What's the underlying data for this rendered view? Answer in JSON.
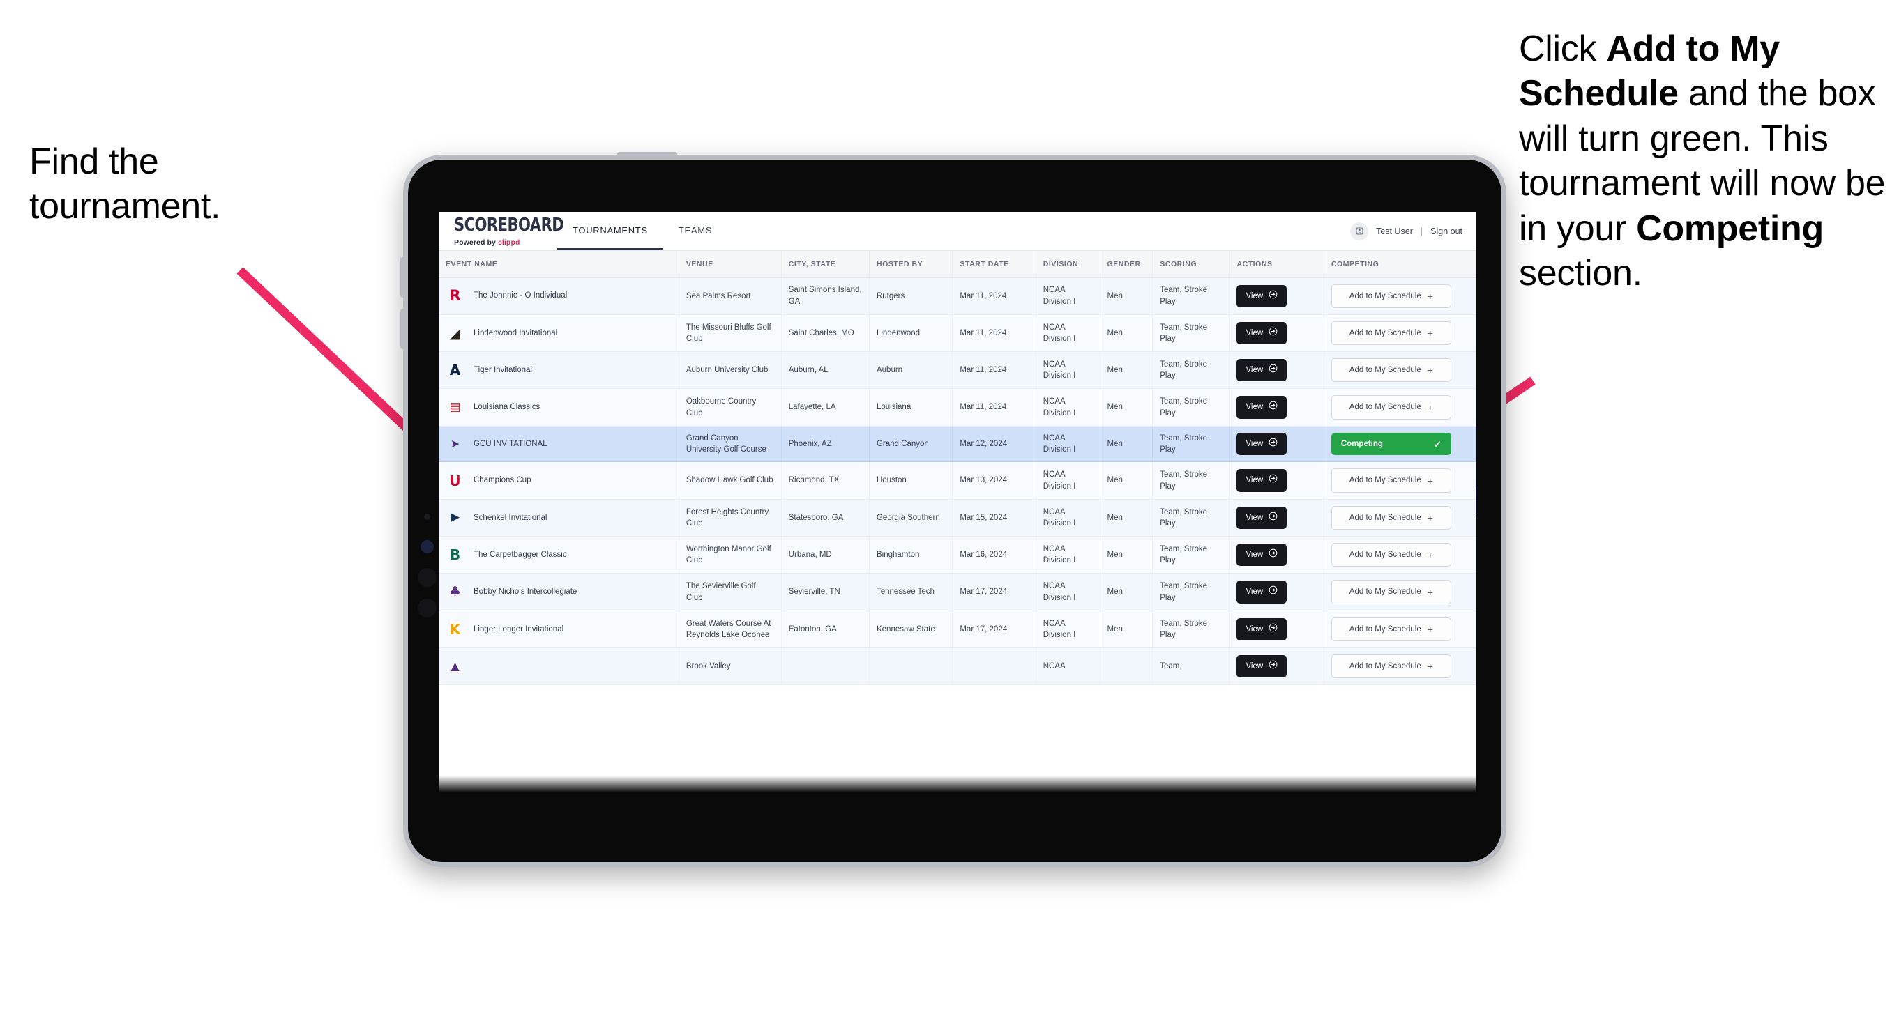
{
  "annotations": {
    "left": {
      "line1": "Find the",
      "line2": "tournament."
    },
    "right": {
      "p1": "Click ",
      "b1": "Add to My Schedule",
      "p2": " and the box will turn green. This tournament will now be in your ",
      "b2": "Competing",
      "p3": " section."
    }
  },
  "app": {
    "brand": {
      "name": "SCOREBOARD",
      "powered_prefix": "Powered by ",
      "powered_brand": "clippd"
    },
    "tabs": [
      {
        "label": "TOURNAMENTS",
        "active": true
      },
      {
        "label": "TEAMS",
        "active": false
      }
    ],
    "user": {
      "avatar_icon": "user-avatar-icon",
      "name": "Test User",
      "separator": "|",
      "sign_out": "Sign out"
    }
  },
  "table": {
    "columns": [
      "EVENT NAME",
      "VENUE",
      "CITY, STATE",
      "HOSTED BY",
      "START DATE",
      "DIVISION",
      "GENDER",
      "SCORING",
      "ACTIONS",
      "COMPETING"
    ],
    "view_label": "View",
    "view_icon": "arrow-right-circle-icon",
    "add_label": "Add to My Schedule",
    "add_icon": "plus-icon",
    "competing_label": "Competing",
    "competing_icon": "check-icon",
    "competing_color": "#22a447",
    "selected_row_color": "#cfe0f8",
    "rows": [
      {
        "logo": "rutgers-logo",
        "name": "The Johnnie - O Individual",
        "venue": "Sea Palms Resort",
        "city": "Saint Simons Island, GA",
        "host": "Rutgers",
        "date": "Mar 11, 2024",
        "division": "NCAA Division I",
        "gender": "Men",
        "scoring": "Team, Stroke Play",
        "competing": false,
        "selected": false
      },
      {
        "logo": "lindenwood-logo",
        "name": "Lindenwood Invitational",
        "venue": "The Missouri Bluffs Golf Club",
        "city": "Saint Charles, MO",
        "host": "Lindenwood",
        "date": "Mar 11, 2024",
        "division": "NCAA Division I",
        "gender": "Men",
        "scoring": "Team, Stroke Play",
        "competing": false,
        "selected": false
      },
      {
        "logo": "auburn-logo",
        "name": "Tiger Invitational",
        "venue": "Auburn University Club",
        "city": "Auburn, AL",
        "host": "Auburn",
        "date": "Mar 11, 2024",
        "division": "NCAA Division I",
        "gender": "Men",
        "scoring": "Team, Stroke Play",
        "competing": false,
        "selected": false
      },
      {
        "logo": "louisiana-ragin-cajuns-logo",
        "name": "Louisiana Classics",
        "venue": "Oakbourne Country Club",
        "city": "Lafayette, LA",
        "host": "Louisiana",
        "date": "Mar 11, 2024",
        "division": "NCAA Division I",
        "gender": "Men",
        "scoring": "Team, Stroke Play",
        "competing": false,
        "selected": false
      },
      {
        "logo": "grand-canyon-lopes-logo",
        "name": "GCU INVITATIONAL",
        "venue": "Grand Canyon University Golf Course",
        "city": "Phoenix, AZ",
        "host": "Grand Canyon",
        "date": "Mar 12, 2024",
        "division": "NCAA Division I",
        "gender": "Men",
        "scoring": "Team, Stroke Play",
        "competing": true,
        "selected": true
      },
      {
        "logo": "houston-cougars-logo",
        "name": "Champions Cup",
        "venue": "Shadow Hawk Golf Club",
        "city": "Richmond, TX",
        "host": "Houston",
        "date": "Mar 13, 2024",
        "division": "NCAA Division I",
        "gender": "Men",
        "scoring": "Team, Stroke Play",
        "competing": false,
        "selected": false
      },
      {
        "logo": "georgia-southern-eagles-logo",
        "name": "Schenkel Invitational",
        "venue": "Forest Heights Country Club",
        "city": "Statesboro, GA",
        "host": "Georgia Southern",
        "date": "Mar 15, 2024",
        "division": "NCAA Division I",
        "gender": "Men",
        "scoring": "Team, Stroke Play",
        "competing": false,
        "selected": false
      },
      {
        "logo": "binghamton-bearcats-logo",
        "name": "The Carpetbagger Classic",
        "venue": "Worthington Manor Golf Club",
        "city": "Urbana, MD",
        "host": "Binghamton",
        "date": "Mar 16, 2024",
        "division": "NCAA Division I",
        "gender": "Men",
        "scoring": "Team, Stroke Play",
        "competing": false,
        "selected": false
      },
      {
        "logo": "tennessee-tech-golden-eagles-logo",
        "name": "Bobby Nichols Intercollegiate",
        "venue": "The Sevierville Golf Club",
        "city": "Sevierville, TN",
        "host": "Tennessee Tech",
        "date": "Mar 17, 2024",
        "division": "NCAA Division I",
        "gender": "Men",
        "scoring": "Team, Stroke Play",
        "competing": false,
        "selected": false
      },
      {
        "logo": "kennesaw-state-owls-logo",
        "name": "Linger Longer Invitational",
        "venue": "Great Waters Course At Reynolds Lake Oconee",
        "city": "Eatonton, GA",
        "host": "Kennesaw State",
        "date": "Mar 17, 2024",
        "division": "NCAA Division I",
        "gender": "Men",
        "scoring": "Team, Stroke Play",
        "competing": false,
        "selected": false
      },
      {
        "logo": "partial-row-logo",
        "name": "",
        "venue": "Brook Valley",
        "city": "",
        "host": "",
        "date": "",
        "division": "NCAA",
        "gender": "",
        "scoring": "Team,",
        "competing": false,
        "selected": false
      }
    ]
  },
  "colors": {
    "arrow_pink": "#ED2A63",
    "tab_active": "#2b3245",
    "brand_accent": "#f0285a"
  }
}
